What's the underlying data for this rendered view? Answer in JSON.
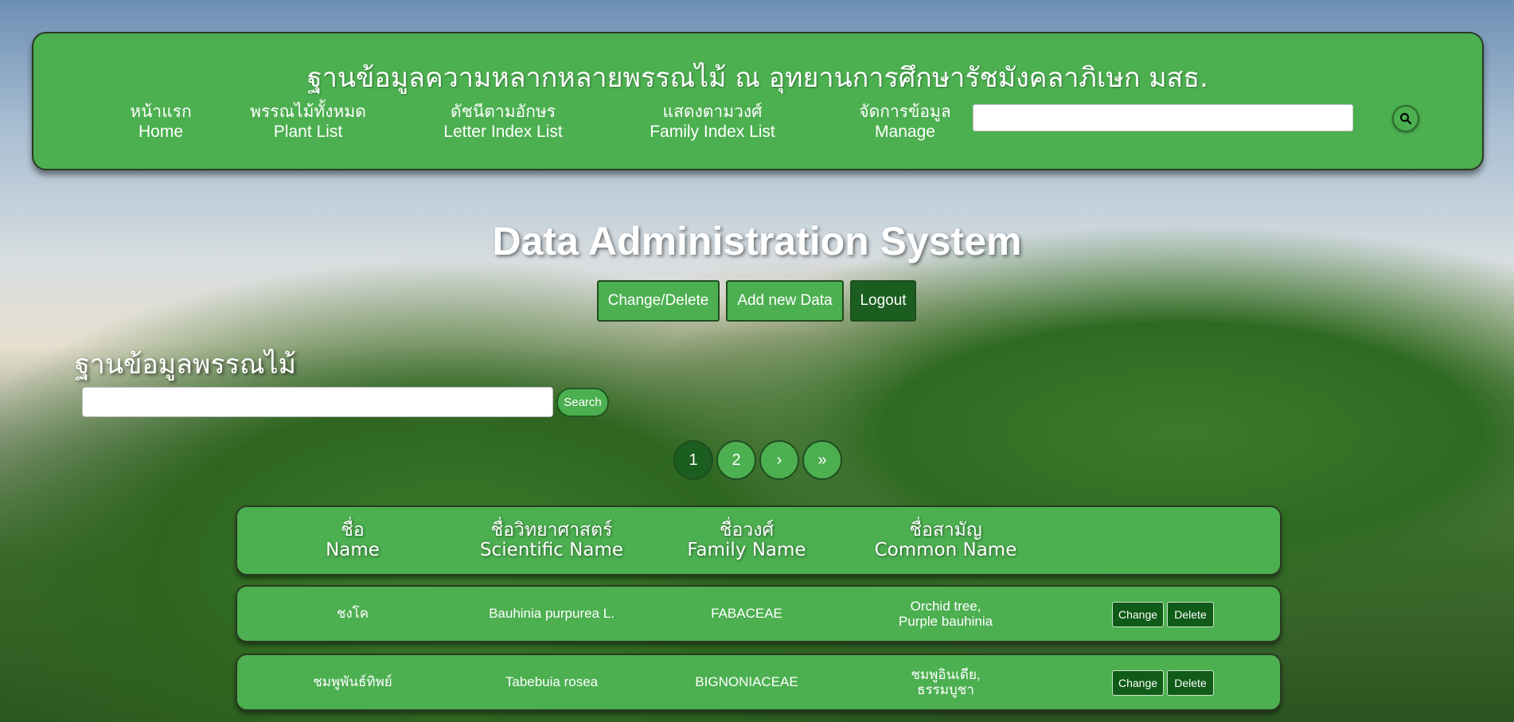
{
  "site_title": "ฐานข้อมูลความหลากหลายพรรณไม้ ณ อุทยานการศึกษารัชมังคลาภิเษก มสธ.",
  "nav": {
    "items": [
      {
        "thai": "หน้าแรก",
        "en": "Home"
      },
      {
        "thai": "พรรณไม้ทั้งหมด",
        "en": "Plant List"
      },
      {
        "thai": "ดัชนีตามอักษร",
        "en": "Letter Index List"
      },
      {
        "thai": "แสดงตามวงศ์",
        "en": "Family Index List"
      },
      {
        "thai": "จัดการข้อมูล",
        "en": "Manage"
      }
    ],
    "search_value": "",
    "search_icon": "magnifier-icon"
  },
  "heading": "Data Administration System",
  "admin_buttons": [
    "Change/Delete",
    "Add new Data",
    "Logout"
  ],
  "db_title": "ฐานข้อมูลพรรณไม้",
  "db_search": {
    "value": "",
    "button_label": "Search"
  },
  "pagination": [
    "1",
    "2",
    "›",
    "»"
  ],
  "current_page": "1",
  "table": {
    "headers": [
      {
        "thai": "ชื่อ",
        "en": "Name"
      },
      {
        "thai": "ชื่อวิทยาศาสตร์",
        "en": "Scientific Name"
      },
      {
        "thai": "ชื่อวงศ์",
        "en": "Family Name"
      },
      {
        "thai": "ชื่อสามัญ",
        "en": "Common Name"
      }
    ],
    "rows": [
      {
        "name": "ชงโค",
        "scientific": "Bauhinia purpurea L.",
        "family": "FABACEAE",
        "common": [
          "Orchid tree,",
          "Purple bauhinia"
        ]
      },
      {
        "name": "ชมพูพันธ์ทิพย์",
        "scientific": "Tabebuia rosea",
        "family": "BIGNONIACEAE",
        "common": [
          "ชมพูอินเดีย,",
          "ธรรมบูชา"
        ]
      }
    ],
    "change_label": "Change",
    "delete_label": "Delete"
  },
  "colors": {
    "panel_green": "#4caf50",
    "dark_green": "#1b5e20",
    "action_green": "#0f5b17"
  }
}
